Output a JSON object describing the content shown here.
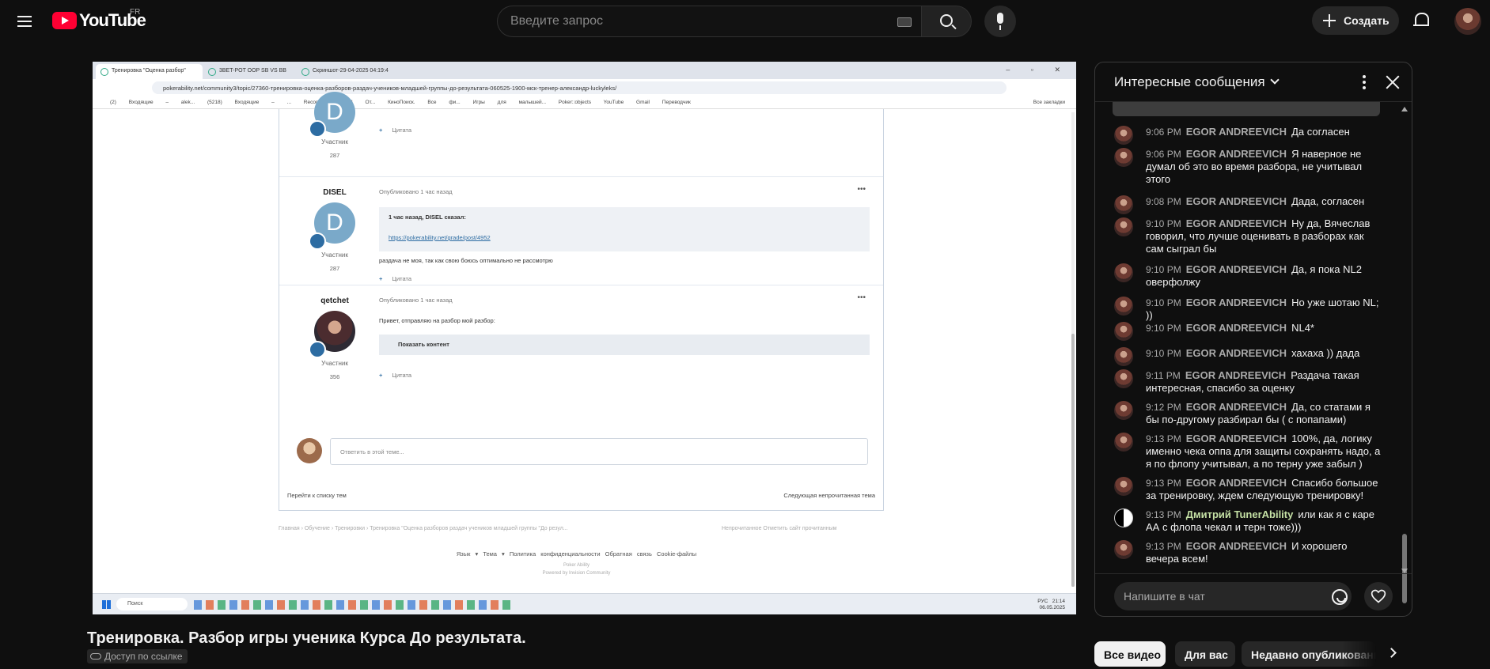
{
  "masthead": {
    "logo_text": "YouTube",
    "country_code": "FR",
    "search_placeholder": "Введите запрос",
    "create_label": "Создать"
  },
  "video": {
    "title": "Тренировка. Разбор игры ученика Курса До результата.",
    "access": "Доступ по ссылке"
  },
  "screen": {
    "tabs": [
      "Тренировка \"Оценка разбор\"",
      "3BET-POT OOP SB VS BB",
      "Скриншот-29-04-2025 04:19:4"
    ],
    "window_controls": "– ▫ ✕",
    "url": "pokerability.net/community3/topic/27360-тренировка-оценка-разборов-раздач-учеников-младшей-группы-до-результата-060525-1900-мск-тренер-александр-luckyleks/",
    "bookmarks": "(2) Входящие – alek...   (5218) Входящие – ...   Recommend.ru | От...   КиноПоиск. Все фи...   Игры для малышей...   Poker::objects   YouTube   Gmail   Переводчик",
    "bookmarks_right": "Все закладки",
    "posts": [
      {
        "role": "Участник",
        "count": "287",
        "cite": "Цитата"
      },
      {
        "author": "DISEL",
        "initial": "D",
        "meta": "Опубликовано 1 час назад",
        "quote_head": "1 час назад, DISEL сказал:",
        "quote_link": "https://pokerability.net/grade/post/4952",
        "text": "раздача не моя, так как свою боюсь оптимально не рассмотрю",
        "role": "Участник",
        "count": "287",
        "cite": "Цитата",
        "dots": "•••"
      },
      {
        "author": "qetchet",
        "meta": "Опубликовано 1 час назад",
        "text": "Привет, отправляю на разбор мой разбор:",
        "show": "Показать контент",
        "role": "Участник",
        "count": "356",
        "cite": "Цитата",
        "dots": "•••"
      }
    ],
    "reply_placeholder": "Ответить в этой теме...",
    "nav_prev": "Перейти к списку тем",
    "nav_next": "Следующая непрочитанная тема",
    "breadcrumb": "Главная  ›  Обучение  ›  Тренировки  ›  Тренировка \"Оценка разборов раздач учеников младшей группы \"До резул...",
    "breadcrumb_right": "Непрочитанное    Отметить сайт прочитанным",
    "footer_links": "Язык ▾   Тема ▾   Политика конфиденциальности   Обратная связь   Cookie-файлы",
    "footer_small_1": "Poker Ability",
    "footer_small_2": "Powered by Invision Community",
    "taskbar_search": "Поиск",
    "tray_time": "21:14",
    "tray_date": "06.05.2025",
    "tray_lang": "РУС"
  },
  "chat": {
    "header": "Интересные сообщения",
    "input_placeholder": "Напишите в чат",
    "messages": [
      {
        "time": "9:06 PM",
        "author": "EGOR ANDREEVICH",
        "text": "Да согласен"
      },
      {
        "time": "9:06 PM",
        "author": "EGOR ANDREEVICH",
        "text": "Я наверное не думал об это во время разбора, не учитывал этого"
      },
      {
        "time": "9:08 PM",
        "author": "EGOR ANDREEVICH",
        "text": "Дада, согласен"
      },
      {
        "time": "9:10 PM",
        "author": "EGOR ANDREEVICH",
        "text": "Ну да, Вячеслав говорил, что лучше оценивать в разборах как сам сыграл бы"
      },
      {
        "time": "9:10 PM",
        "author": "EGOR ANDREEVICH",
        "text": "Да, я пока NL2 оверфолжу"
      },
      {
        "time": "9:10 PM",
        "author": "EGOR ANDREEVICH",
        "text": "Но уже шотаю NL; ))"
      },
      {
        "time": "9:10 PM",
        "author": "EGOR ANDREEVICH",
        "text": "NL4*"
      },
      {
        "time": "9:10 PM",
        "author": "EGOR ANDREEVICH",
        "text": "хахаха )) дада"
      },
      {
        "time": "9:11 PM",
        "author": "EGOR ANDREEVICH",
        "text": "Раздача такая интересная, спасибо за оценку"
      },
      {
        "time": "9:12 PM",
        "author": "EGOR ANDREEVICH",
        "text": "Да, со статами я бы по-другому разбирал бы ( с попапами)"
      },
      {
        "time": "9:13 PM",
        "author": "EGOR ANDREEVICH",
        "text": "100%, да, логику именно чека оппа для защиты сохранять надо, а я по флопу учитывал, а по терну уже забыл )"
      },
      {
        "time": "9:13 PM",
        "author": "EGOR ANDREEVICH",
        "text": "Спасибо большое за тренировку, ждем следующую тренировку!"
      },
      {
        "time": "9:13 PM",
        "author": "Дмитрий TunerAbility",
        "text": "или как я с каре АА с флопа чекал и терн тоже)))",
        "member": true
      },
      {
        "time": "9:13 PM",
        "author": "EGOR ANDREEVICH",
        "text": "И хорошего вечера всем!"
      }
    ]
  },
  "chips": [
    "Все видео",
    "Для вас",
    "Недавно опубликованные"
  ],
  "colors": {
    "background": "#0f0f0f",
    "brand_red": "#ff0033",
    "chip_active": "#f1f1f1",
    "member_name": "#c5e1a5"
  }
}
